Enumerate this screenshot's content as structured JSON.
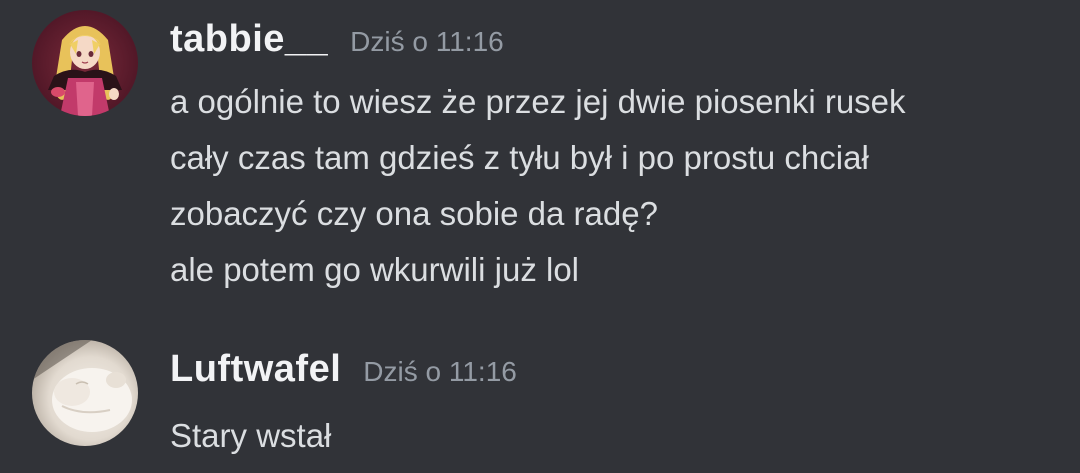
{
  "messages": [
    {
      "username": "tabbie__",
      "timestamp": "Dziś o 11:16",
      "lines": [
        "a ogólnie to wiesz że przez jej dwie piosenki rusek",
        "cały czas tam gdzieś z tyłu był i po prostu chciał",
        "zobaczyć czy ona sobie da radę?",
        "ale potem go wkurwili już lol"
      ]
    },
    {
      "username": "Luftwafel",
      "timestamp": "Dziś o 11:16",
      "lines": [
        "Stary wstał"
      ]
    }
  ],
  "colors": {
    "background": "#313338",
    "username": "#f2f3f5",
    "timestamp": "#949ba4",
    "message_text": "#dbdee1"
  }
}
